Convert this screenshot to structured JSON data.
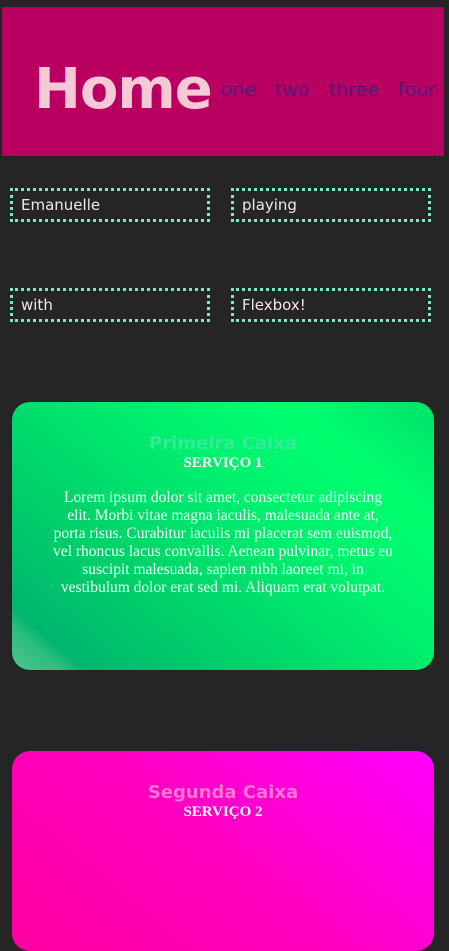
{
  "header": {
    "title": "Home",
    "nav": [
      "one",
      "two",
      "three",
      "four"
    ]
  },
  "tags": [
    "Emanuelle",
    "playing",
    "with",
    "Flexbox!"
  ],
  "cards": [
    {
      "title": "Primeira Caixa",
      "subtitle": "SERVIÇO 1",
      "body": "Lorem ipsum dolor sit amet, consectetur adipiscing elit. Morbi vitae magna iaculis, malesuada ante at, porta risus. Curabitur iaculis mi placerat sem euismod, vel rhoncus lacus convallis. Aenean pulvinar, metus eu suscipit malesuada, sapien nibh laoreet mi, in vestibulum dolor erat sed mi. Aliquam erat volutpat."
    },
    {
      "title": "Segunda Caixa",
      "subtitle": "SERVIÇO 2"
    }
  ],
  "colors": {
    "background": "#252525",
    "header": "#b90060",
    "title": "#f6c9d6",
    "nav_link": "#51197f",
    "tag_border": "#7be9c7",
    "card1": "#00f06e",
    "card2": "#ff00c0"
  }
}
